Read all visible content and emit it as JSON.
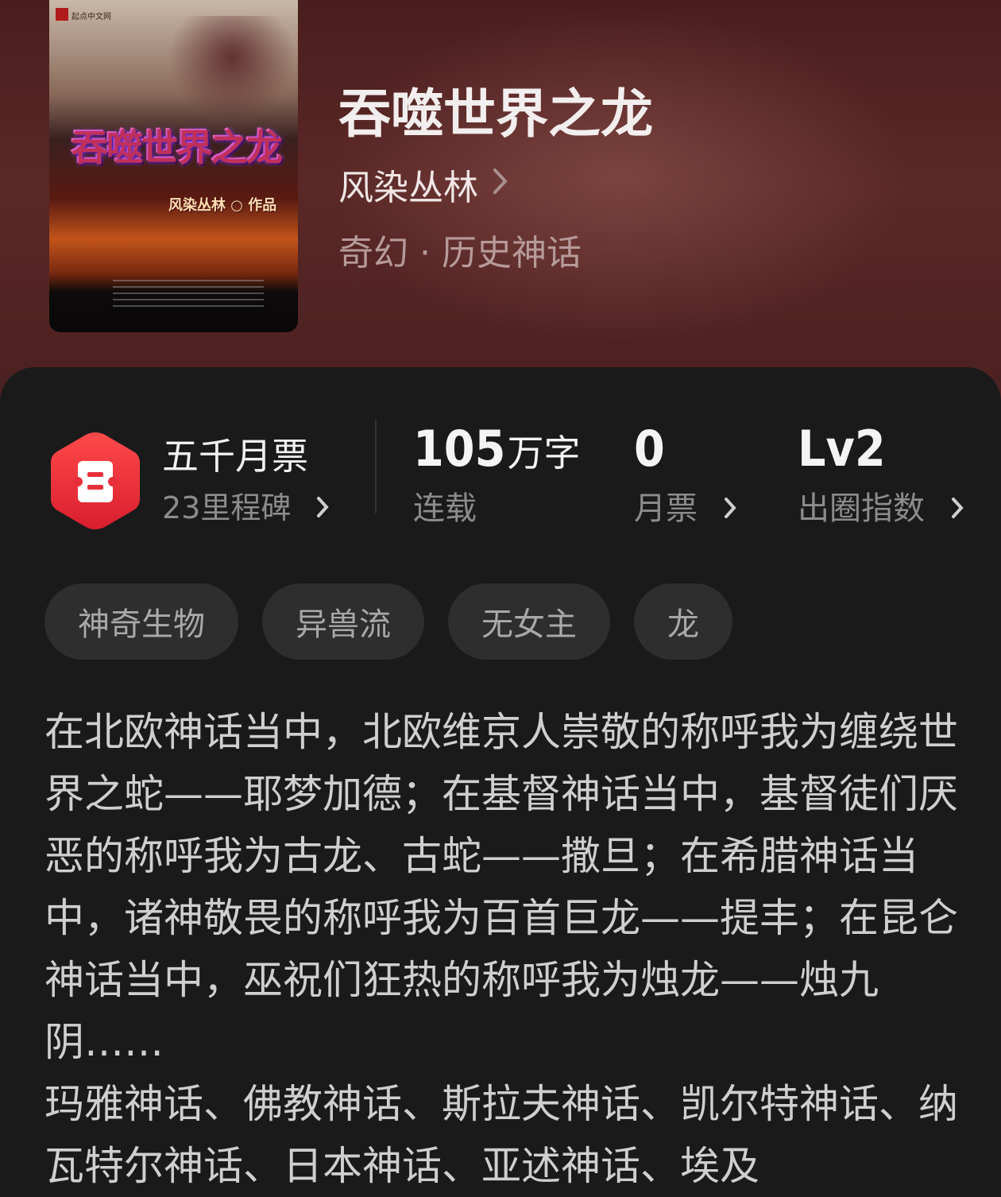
{
  "book": {
    "title": "吞噬世界之龙",
    "author": "风染丛林",
    "genre": "奇幻 · 历史神话",
    "cover": {
      "title_art": "吞噬世界之龙",
      "author_line": "风染丛林 ○ 作品",
      "publisher": "起点中文网"
    }
  },
  "stats": {
    "ticket_title": "五千月票",
    "milestones": "23里程碑",
    "word_count_number": "105",
    "word_count_unit": "万字",
    "word_count_label": "连载",
    "monthly_tickets_value": "0",
    "monthly_tickets_label": "月票",
    "breakout_value": "Lv2",
    "breakout_label": "出圈指数"
  },
  "tags": [
    "神奇生物",
    "异兽流",
    "无女主",
    "龙"
  ],
  "description": "在北欧神话当中，北欧维京人崇敬的称呼我为缠绕世界之蛇——耶梦加德；在基督神话当中，基督徒们厌恶的称呼我为古龙、古蛇——撒旦；在希腊神话当中，诸神敬畏的称呼我为百首巨龙——提丰；在昆仑神话当中，巫祝们狂热的称呼我为烛龙——烛九阴……\n玛雅神话、佛教神话、斯拉夫神话、凯尔特神话、纳瓦特尔神话、日本神话、亚述神话、埃及",
  "colors": {
    "hero_bg": "#4a1e1e",
    "panel_bg": "#1a1a1a",
    "badge_red": "#e8303a",
    "tag_bg": "#2e2e2e"
  },
  "icons": [
    "chevron-right-icon",
    "ticket-badge-icon"
  ]
}
